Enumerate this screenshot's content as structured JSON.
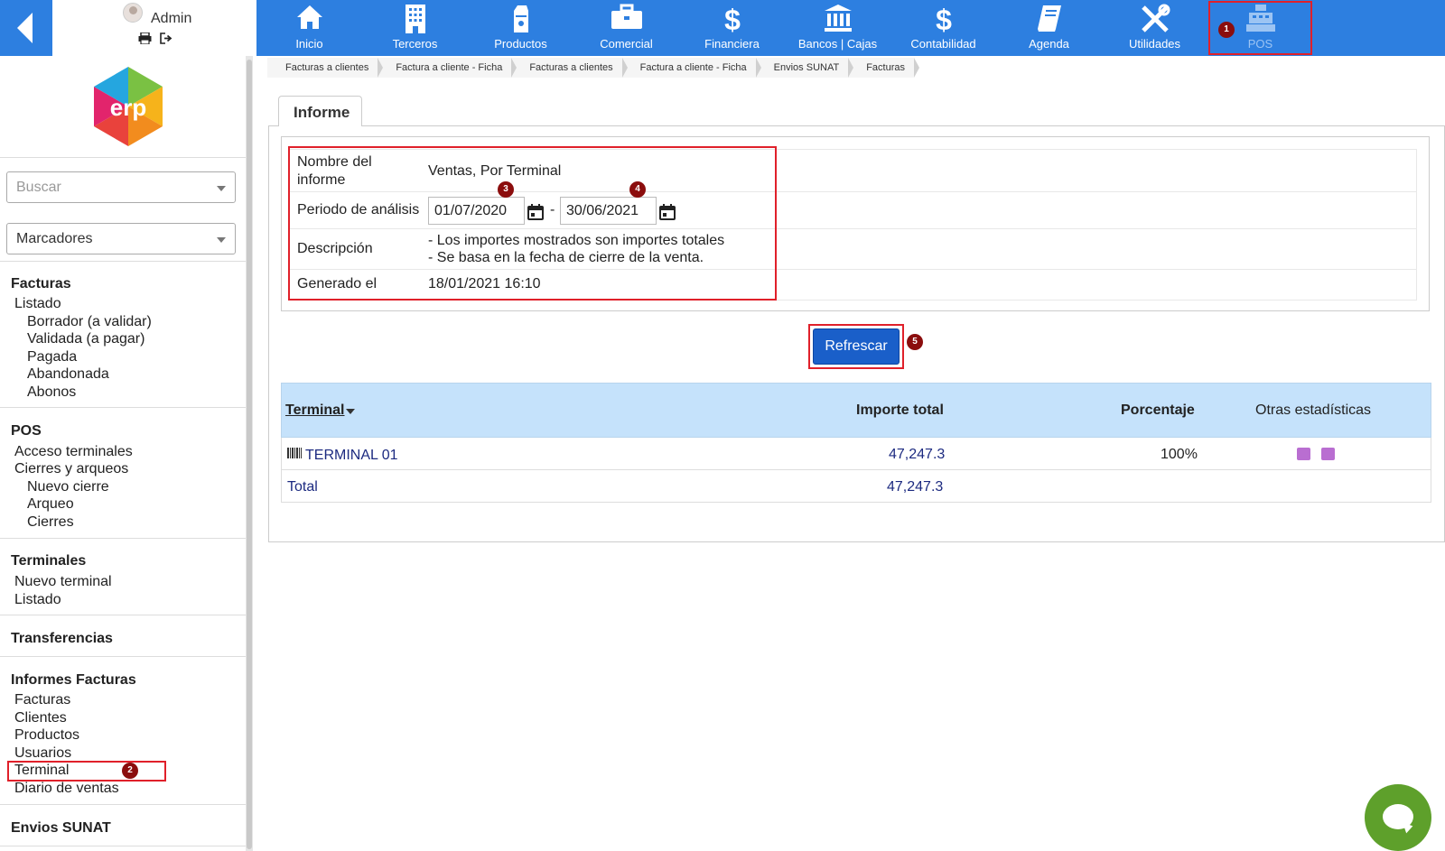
{
  "app": {
    "user_name": "Admin"
  },
  "nav": {
    "items": [
      {
        "label": "Inicio",
        "icon": "home-icon"
      },
      {
        "label": "Terceros",
        "icon": "building-icon"
      },
      {
        "label": "Productos",
        "icon": "box-icon"
      },
      {
        "label": "Comercial",
        "icon": "briefcase-icon"
      },
      {
        "label": "Financiera",
        "icon": "dollar-icon"
      },
      {
        "label": "Bancos | Cajas",
        "icon": "bank-icon"
      },
      {
        "label": "Contabilidad",
        "icon": "dollar-icon"
      },
      {
        "label": "Agenda",
        "icon": "book-icon"
      },
      {
        "label": "Utilidades",
        "icon": "tools-icon"
      },
      {
        "label": "POS",
        "icon": "cash-register-icon",
        "active": true
      }
    ]
  },
  "breadcrumb": [
    "Facturas a clientes",
    "Factura a cliente - Ficha",
    "Facturas a clientes",
    "Factura a cliente - Ficha",
    "Envios SUNAT",
    "Facturas"
  ],
  "sidebar": {
    "search_placeholder": "Buscar",
    "bookmarks_label": "Marcadores",
    "sections": {
      "facturas": {
        "title": "Facturas",
        "listado": "Listado",
        "borrador": "Borrador (a validar)",
        "validada": "Validada (a pagar)",
        "pagada": "Pagada",
        "abandonada": "Abandonada",
        "abonos": "Abonos"
      },
      "pos": {
        "title": "POS",
        "acceso": "Acceso terminales",
        "cierres": "Cierres y arqueos",
        "nuevo_cierre": "Nuevo cierre",
        "arqueo": "Arqueo",
        "cierres_list": "Cierres"
      },
      "terminales": {
        "title": "Terminales",
        "nuevo": "Nuevo terminal",
        "listado": "Listado"
      },
      "transferencias": {
        "title": "Transferencias"
      },
      "informes": {
        "title": "Informes Facturas",
        "facturas": "Facturas",
        "clientes": "Clientes",
        "productos": "Productos",
        "usuarios": "Usuarios",
        "terminal": "Terminal",
        "diario": "Diario de ventas"
      },
      "envios": {
        "title": "Envios SUNAT"
      }
    }
  },
  "report": {
    "tab_label": "Informe",
    "name_label": "Nombre del informe",
    "name_value": "Ventas, Por Terminal",
    "period_label": "Periodo de análisis",
    "date_from": "01/07/2020",
    "date_sep": "-",
    "date_to": "30/06/2021",
    "description_label": "Descripción",
    "description_line1": "- Los importes mostrados son importes totales",
    "description_line2": "- Se basa en la fecha de cierre de la venta.",
    "generated_label": "Generado el",
    "generated_value": "18/01/2021 16:10",
    "refresh_button": "Refrescar"
  },
  "table": {
    "headers": {
      "terminal": "Terminal",
      "importe": "Importe total",
      "porcentaje": "Porcentaje",
      "otras": "Otras estadísticas"
    },
    "rows": [
      {
        "terminal": "TERMINAL 01",
        "importe": "47,247.3",
        "porcentaje": "100%"
      }
    ],
    "total_label": "Total",
    "total_value": "47,247.3"
  },
  "annotations": {
    "b1": "1",
    "b2": "2",
    "b3": "3",
    "b4": "4",
    "b5": "5"
  },
  "colors": {
    "topbar": "#2d7fe0",
    "highlight": "#e0202a",
    "badge": "#8b0d0d",
    "table_header": "#c5e2fb",
    "button": "#1a5fc9",
    "chat": "#5ea02b"
  }
}
